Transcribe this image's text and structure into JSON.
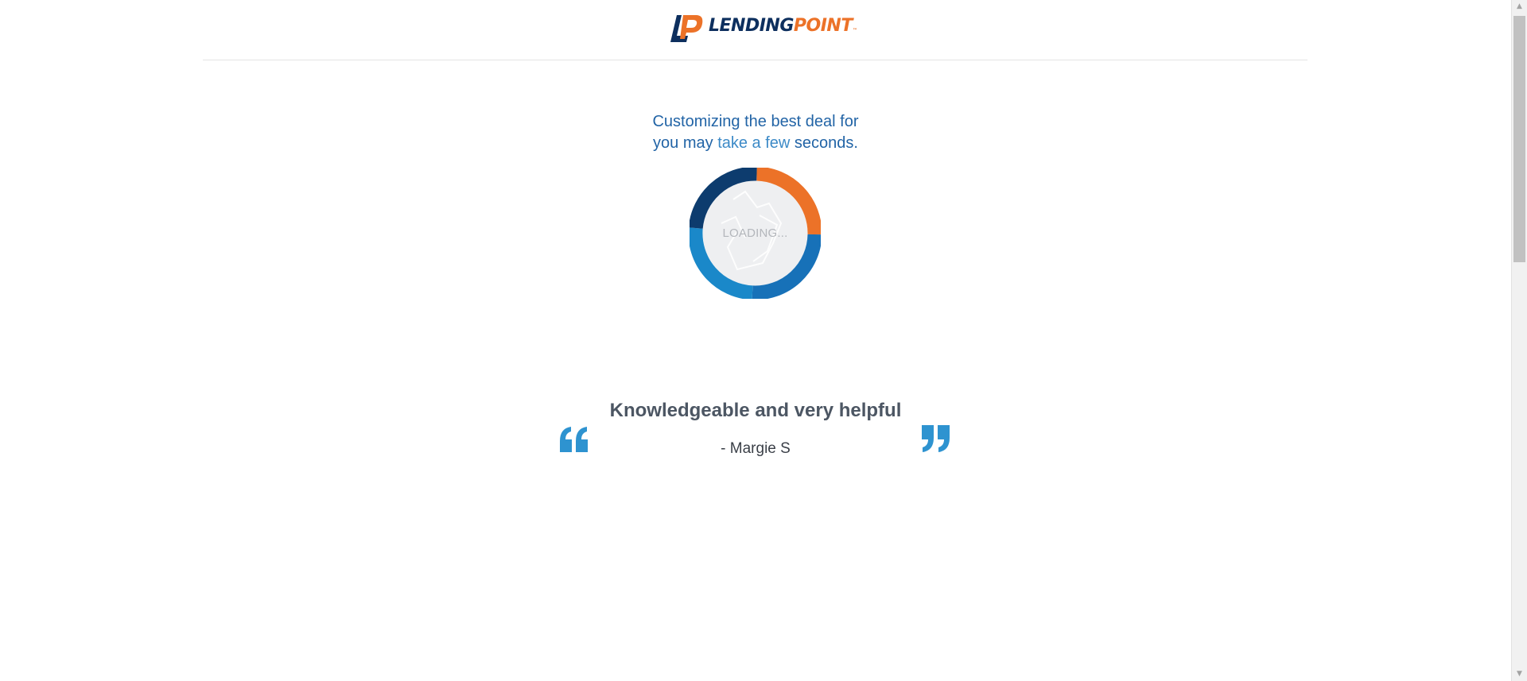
{
  "header": {
    "logo": {
      "name_part1": "LENDING",
      "name_part2": "POINT",
      "trademark": "™",
      "colors": {
        "navy": "#0d2f5e",
        "orange": "#ec7228"
      }
    }
  },
  "status": {
    "line1": "Customizing the best deal for",
    "line2_prefix": "you may ",
    "line2_highlight": "take a few",
    "line2_suffix": " seconds."
  },
  "spinner": {
    "label": "LOADING...",
    "colors": [
      "#ec7228",
      "#1771b8",
      "#1a88c9",
      "#0d3c6e"
    ]
  },
  "testimonial": {
    "text": "Knowledgeable and very helpful",
    "author": "- Margie S",
    "quote_color": "#2e93d0"
  },
  "scrollbar": {
    "up_icon": "▲",
    "down_icon": "▼"
  }
}
